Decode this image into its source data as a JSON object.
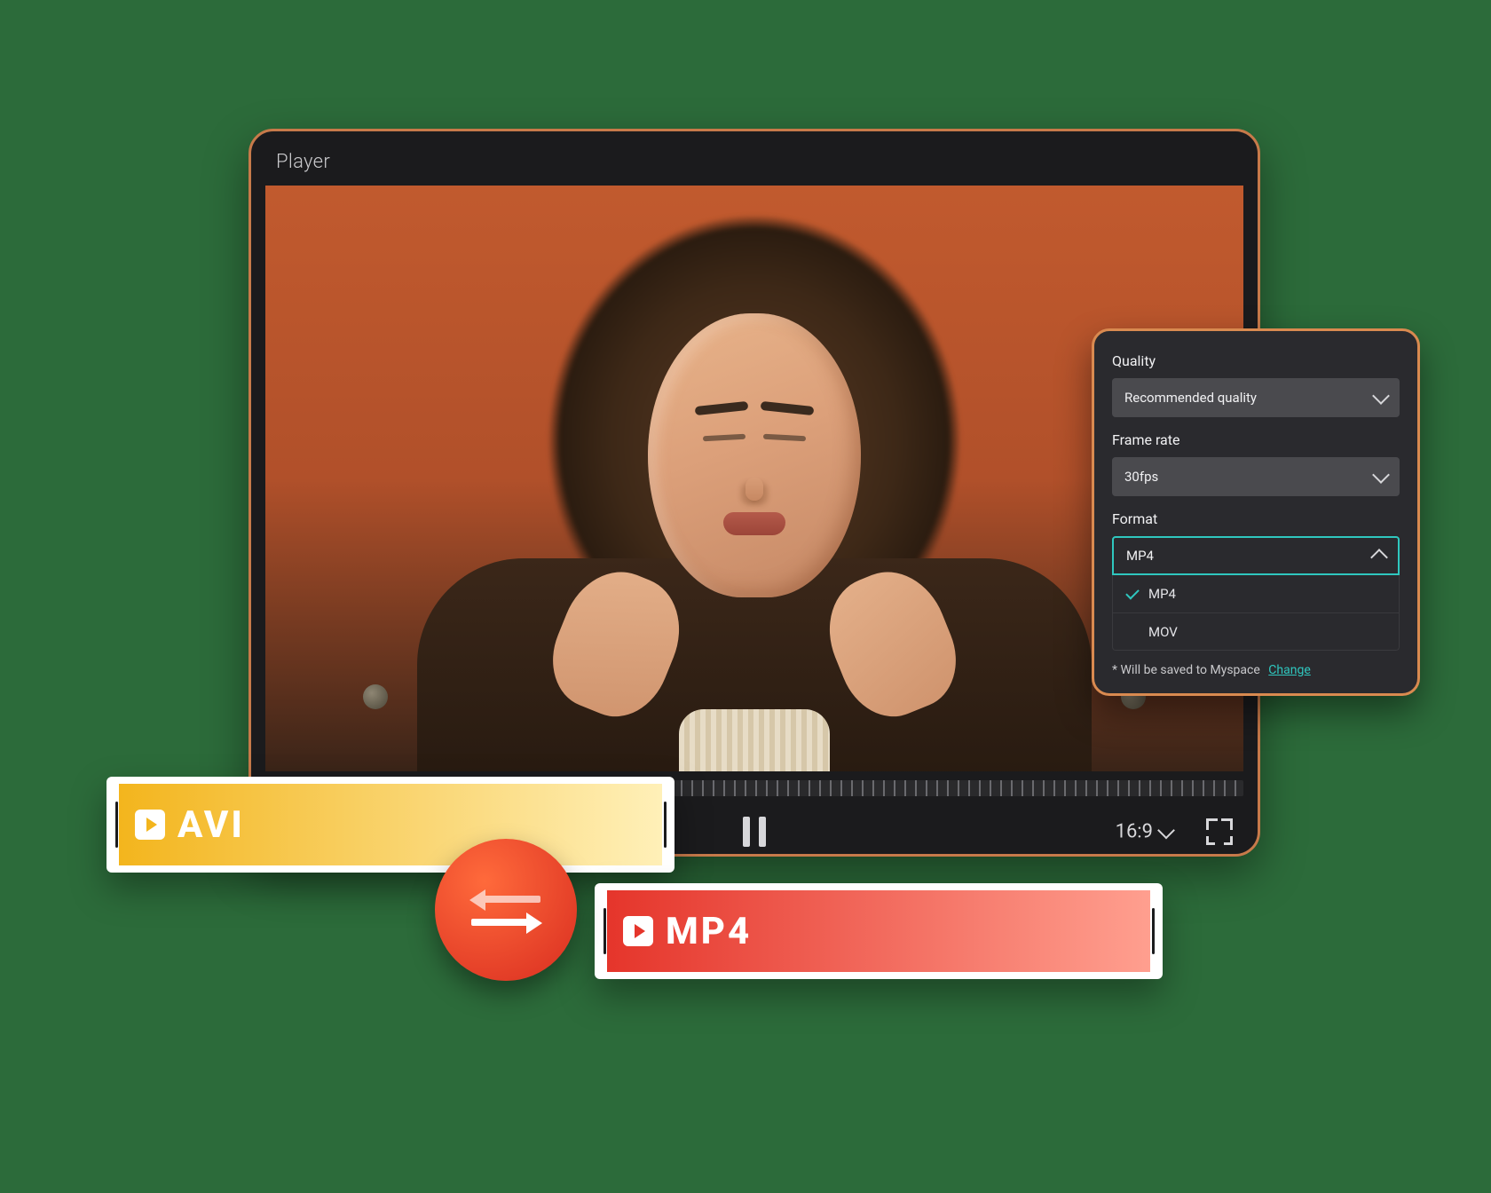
{
  "player": {
    "title": "Player",
    "aspect_ratio": "16:9"
  },
  "settings": {
    "quality": {
      "label": "Quality",
      "value": "Recommended quality"
    },
    "frame_rate": {
      "label": "Frame rate",
      "value": "30fps"
    },
    "format": {
      "label": "Format",
      "value": "MP4",
      "options": [
        "MP4",
        "MOV"
      ],
      "selected": "MP4"
    },
    "footnote_text": "* Will be saved to Myspace",
    "footnote_link": "Change"
  },
  "chips": {
    "source": "AVI",
    "target": "MP4"
  }
}
